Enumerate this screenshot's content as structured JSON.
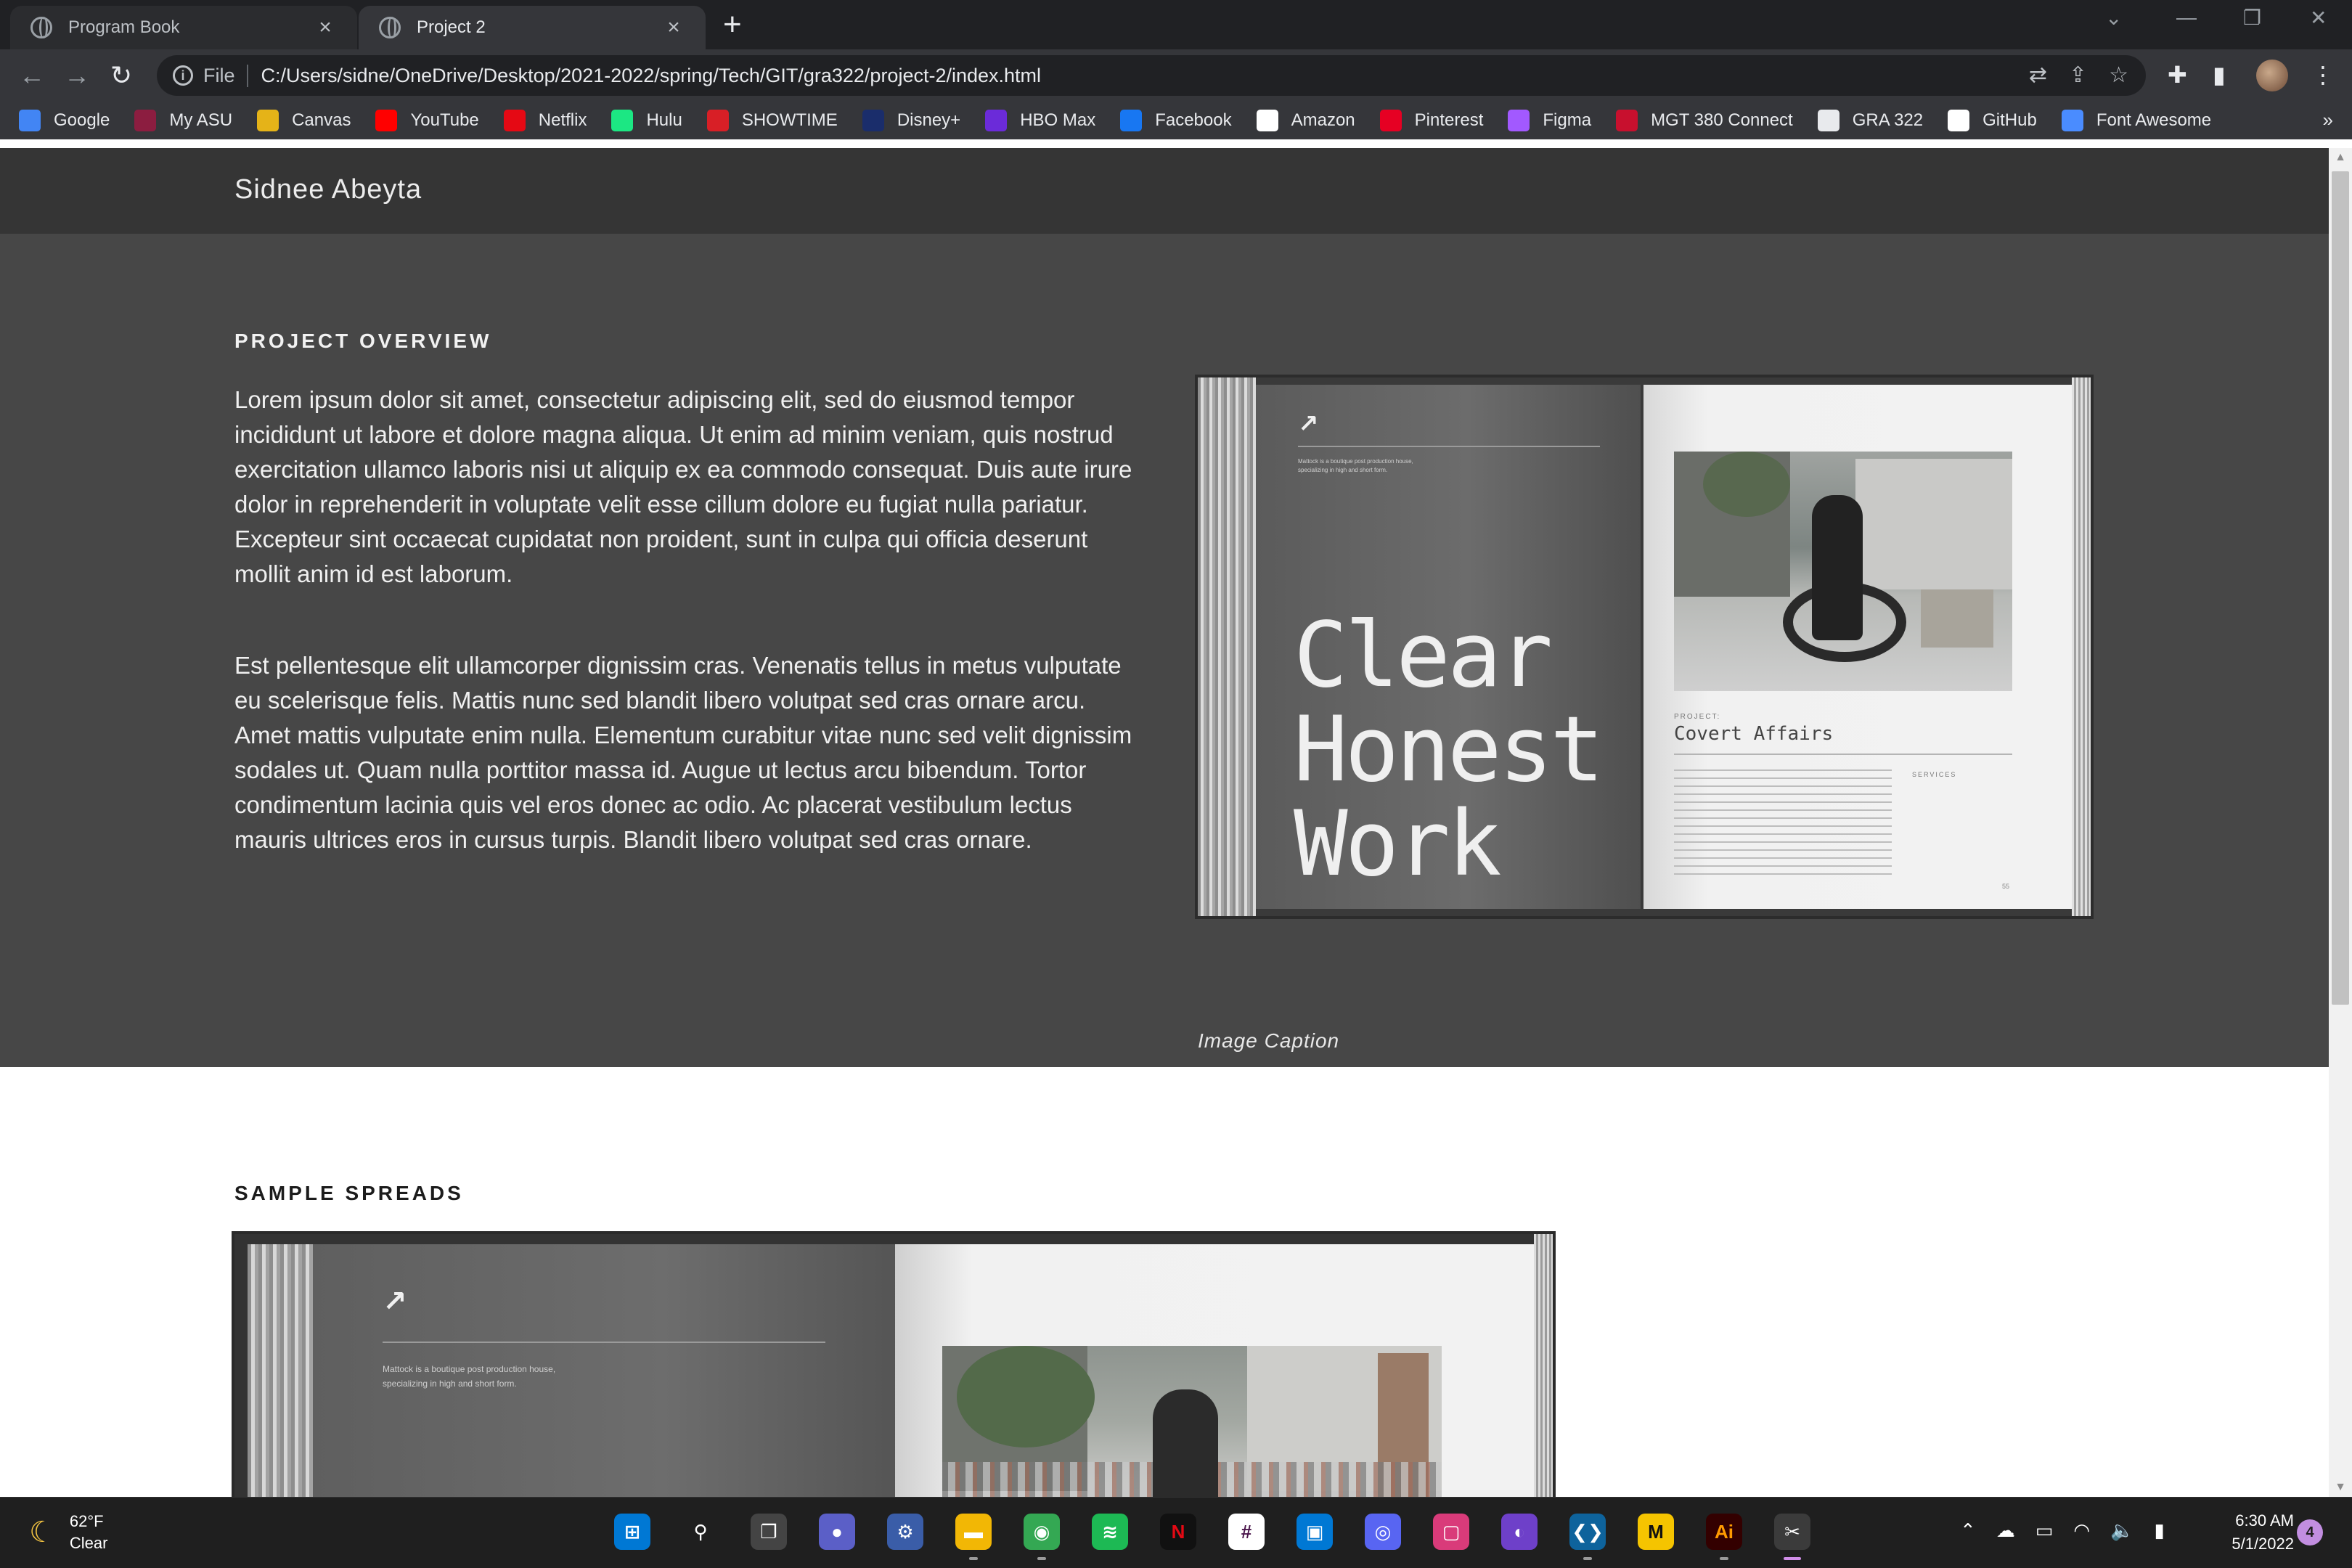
{
  "browser": {
    "tabs": [
      {
        "label": "Program Book"
      },
      {
        "label": "Project 2"
      }
    ],
    "address": {
      "scheme_label": "File",
      "url": "C:/Users/sidne/OneDrive/Desktop/2021-2022/spring/Tech/GIT/gra322/project-2/index.html"
    },
    "bookmarks": [
      {
        "label": "Google",
        "icon": "google-icon",
        "color": "#4285f4"
      },
      {
        "label": "My ASU",
        "icon": "asu-icon",
        "color": "#8c1d40"
      },
      {
        "label": "Canvas",
        "icon": "canvas-icon",
        "color": "#e5b318"
      },
      {
        "label": "YouTube",
        "icon": "youtube-icon",
        "color": "#ff0000"
      },
      {
        "label": "Netflix",
        "icon": "netflix-icon",
        "color": "#e50914"
      },
      {
        "label": "Hulu",
        "icon": "hulu-icon",
        "color": "#1ce783"
      },
      {
        "label": "SHOWTIME",
        "icon": "showtime-icon",
        "color": "#d81f26"
      },
      {
        "label": "Disney+",
        "icon": "disney-icon",
        "color": "#1a2d6b"
      },
      {
        "label": "HBO Max",
        "icon": "hbomax-icon",
        "color": "#6b2bd9"
      },
      {
        "label": "Facebook",
        "icon": "facebook-icon",
        "color": "#1877f2"
      },
      {
        "label": "Amazon",
        "icon": "amazon-icon",
        "color": "#ffffff"
      },
      {
        "label": "Pinterest",
        "icon": "pinterest-icon",
        "color": "#e60023"
      },
      {
        "label": "Figma",
        "icon": "figma-icon",
        "color": "#a259ff"
      },
      {
        "label": "MGT 380 Connect",
        "icon": "connect-icon",
        "color": "#c8102e"
      },
      {
        "label": "GRA 322",
        "icon": "page-icon",
        "color": "#e8eaed"
      },
      {
        "label": "GitHub",
        "icon": "github-icon",
        "color": "#ffffff"
      },
      {
        "label": "Font Awesome",
        "icon": "flag-icon",
        "color": "#4a8cff"
      }
    ],
    "bookmarks_overflow": "»"
  },
  "page": {
    "site_name": "Sidnee Abeyta",
    "overview": {
      "heading": "PROJECT OVERVIEW",
      "paragraphs": [
        "Lorem ipsum dolor sit amet, consectetur adipiscing elit, sed do eiusmod tempor incididunt ut labore et dolore magna aliqua. Ut enim ad minim veniam, quis nostrud exercitation ullamco laboris nisi ut aliquip ex ea commodo consequat. Duis aute irure dolor in reprehenderit in voluptate velit esse cillum dolore eu fugiat nulla pariatur. Excepteur sint occaecat cupidatat non proident, sunt in culpa qui officia deserunt mollit anim id est laborum.",
        "Est pellentesque elit ullamcorper dignissim cras. Venenatis tellus in metus vulputate eu scelerisque felis. Mattis nunc sed blandit libero volutpat sed cras ornare arcu. Amet mattis vulputate enim nulla. Elementum curabitur vitae nunc sed velit dignissim sodales ut. Quam nulla porttitor massa id. Augue ut lectus arcu bibendum. Tortor condimentum lacinia quis vel eros donec ac odio. Ac placerat vestibulum lectus mauris ultrices eros in cursus turpis. Blandit libero volutpat sed cras ornare."
      ],
      "image": {
        "left_page_blurb": "Mattock is a boutique post production house, specializing in high and short form.",
        "title_lines": [
          "Clear",
          "Honest",
          "Work"
        ],
        "project_label": "PROJECT:",
        "project_name": "Covert Affairs",
        "services_label": "SERVICES",
        "page_number": "55"
      },
      "caption": "Image Caption"
    },
    "spreads": {
      "heading": "SAMPLE SPREADS",
      "left_page_blurb": "Mattock is a boutique post production house, specializing in high and short form."
    }
  },
  "taskbar": {
    "weather_temp": "62°F",
    "weather_desc": "Clear",
    "time": "6:30 AM",
    "date": "5/1/2022",
    "notification_count": "4"
  }
}
